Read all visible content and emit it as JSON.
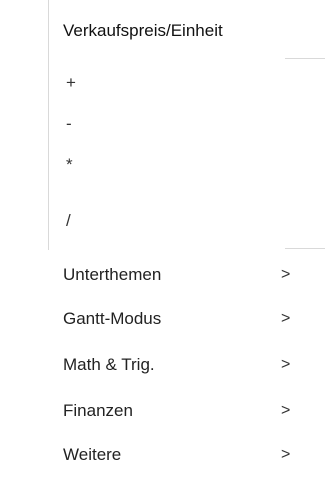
{
  "menu": {
    "header": "Verkaufspreis/Einheit",
    "operators": [
      "+",
      "-",
      "*",
      "/"
    ],
    "submenus": [
      {
        "label": "Unterthemen",
        "chevron": ">"
      },
      {
        "label": "Gantt-Modus",
        "chevron": ">"
      },
      {
        "label": "Math & Trig.",
        "chevron": ">"
      },
      {
        "label": "Finanzen",
        "chevron": ">"
      },
      {
        "label": "Weitere",
        "chevron": ">"
      }
    ]
  }
}
